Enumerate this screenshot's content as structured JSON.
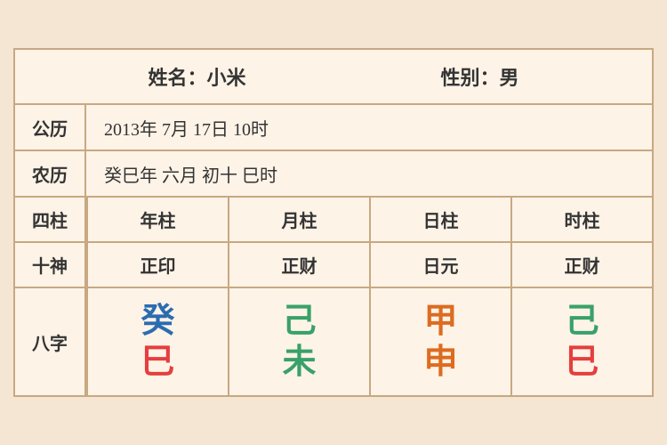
{
  "header": {
    "name_label": "姓名：小米",
    "gender_label": "性别：男"
  },
  "rows": {
    "solar_label": "公历",
    "solar_value": "2013年 7月 17日 10时",
    "lunar_label": "农历",
    "lunar_value": "癸巳年 六月 初十 巳时"
  },
  "pillars": {
    "label": "四柱",
    "columns": [
      "年柱",
      "月柱",
      "日柱",
      "时柱"
    ]
  },
  "shishen": {
    "label": "十神",
    "columns": [
      "正印",
      "正财",
      "日元",
      "正财"
    ]
  },
  "bazi": {
    "label": "八字",
    "cells": [
      {
        "top": "癸",
        "top_color": "color-blue",
        "bottom": "巳",
        "bottom_color": "color-red"
      },
      {
        "top": "己",
        "top_color": "color-green",
        "bottom": "未",
        "bottom_color": "color-green"
      },
      {
        "top": "甲",
        "top_color": "color-orange",
        "bottom": "申",
        "bottom_color": "color-orange"
      },
      {
        "top": "己",
        "top_color": "color-green",
        "bottom": "巳",
        "bottom_color": "color-red"
      }
    ]
  }
}
